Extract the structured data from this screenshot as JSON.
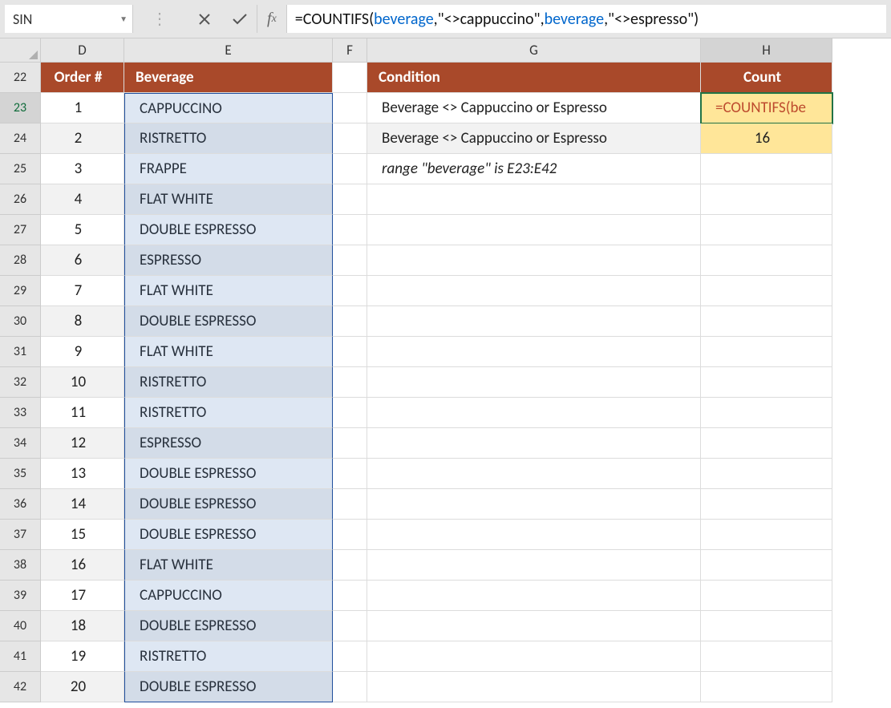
{
  "nameBox": "SIN",
  "formula": {
    "prefix": "=COUNTIFS(",
    "ref1": "beverage",
    "mid1": ",\"<>cappuccino\",",
    "ref2": "beverage",
    "suffix": ",\"<>espresso\")"
  },
  "columns": [
    "D",
    "E",
    "F",
    "G",
    "H"
  ],
  "headers": {
    "D": "Order #",
    "E": "Beverage",
    "G": "Condition",
    "H": "Count"
  },
  "orders": [
    {
      "n": "1",
      "b": "CAPPUCCINO"
    },
    {
      "n": "2",
      "b": "RISTRETTO"
    },
    {
      "n": "3",
      "b": "FRAPPE"
    },
    {
      "n": "4",
      "b": "FLAT WHITE"
    },
    {
      "n": "5",
      "b": "DOUBLE ESPRESSO"
    },
    {
      "n": "6",
      "b": "ESPRESSO"
    },
    {
      "n": "7",
      "b": "FLAT WHITE"
    },
    {
      "n": "8",
      "b": "DOUBLE ESPRESSO"
    },
    {
      "n": "9",
      "b": "FLAT WHITE"
    },
    {
      "n": "10",
      "b": "RISTRETTO"
    },
    {
      "n": "11",
      "b": "RISTRETTO"
    },
    {
      "n": "12",
      "b": "ESPRESSO"
    },
    {
      "n": "13",
      "b": "DOUBLE ESPRESSO"
    },
    {
      "n": "14",
      "b": "DOUBLE ESPRESSO"
    },
    {
      "n": "15",
      "b": "DOUBLE ESPRESSO"
    },
    {
      "n": "16",
      "b": "FLAT WHITE"
    },
    {
      "n": "17",
      "b": "CAPPUCCINO"
    },
    {
      "n": "18",
      "b": "DOUBLE ESPRESSO"
    },
    {
      "n": "19",
      "b": "RISTRETTO"
    },
    {
      "n": "20",
      "b": "DOUBLE ESPRESSO"
    }
  ],
  "right": {
    "cond1": "Beverage <> Cappuccino or Espresso",
    "cond2": "Beverage <> Cappuccino or Espresso",
    "h23": "=COUNTIFS(be",
    "h24": "16",
    "note": "range \"beverage\" is E23:E42"
  },
  "rowStart": 22,
  "rowEnd": 42
}
